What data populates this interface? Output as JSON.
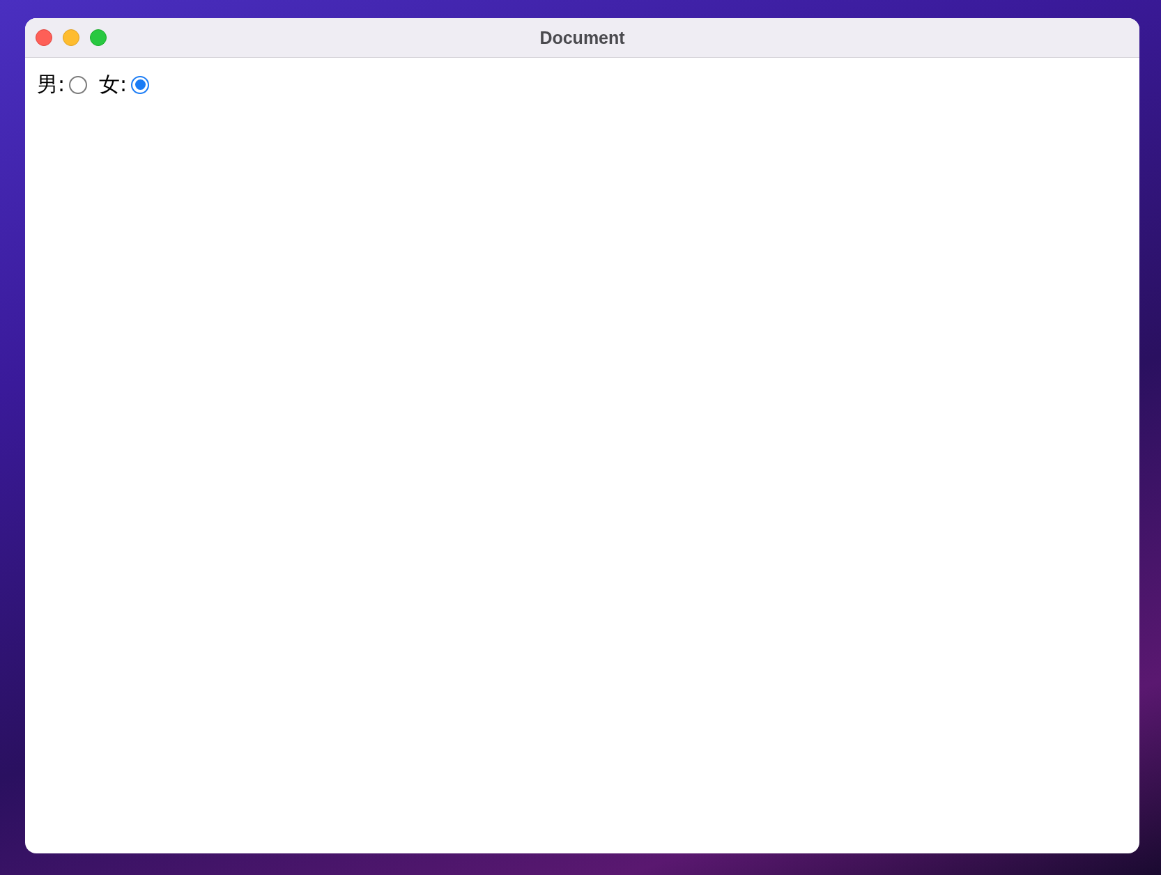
{
  "window": {
    "title": "Document"
  },
  "radio_group": [
    {
      "label": "男:",
      "selected": false
    },
    {
      "label": "女:",
      "selected": true
    }
  ]
}
